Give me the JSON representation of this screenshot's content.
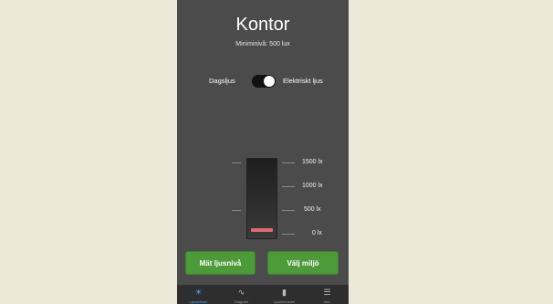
{
  "screen": {
    "title": "Kontor",
    "subtitle": "Miniminivå: 500 lux"
  },
  "mode_toggle": {
    "left_label": "Dagsljus",
    "right_label": "Elektriskt ljus",
    "selected": "Elektriskt ljus"
  },
  "meter": {
    "scale_labels": [
      "1500 lx",
      "1000 lx",
      "500 lx",
      "0 lx"
    ],
    "current_level_lx": 0,
    "bar_color": "#e06a74"
  },
  "buttons": {
    "measure_label": "Mät ljusnivå",
    "choose_label": "Välj miljö",
    "color": "#4d9a3a"
  },
  "tabbar": {
    "tabs": [
      {
        "label": "Ljusmätare",
        "icon": "sun-icon",
        "active": true
      },
      {
        "label": "Diagram",
        "icon": "chart-icon",
        "active": false
      },
      {
        "label": "Ljusintensitet",
        "icon": "document-icon",
        "active": false
      },
      {
        "label": "Mer",
        "icon": "list-icon",
        "active": false
      }
    ]
  },
  "colors": {
    "page_background": "#ede9d9",
    "app_background": "#4b4b4b",
    "active_tab": "#4aa3f2"
  }
}
